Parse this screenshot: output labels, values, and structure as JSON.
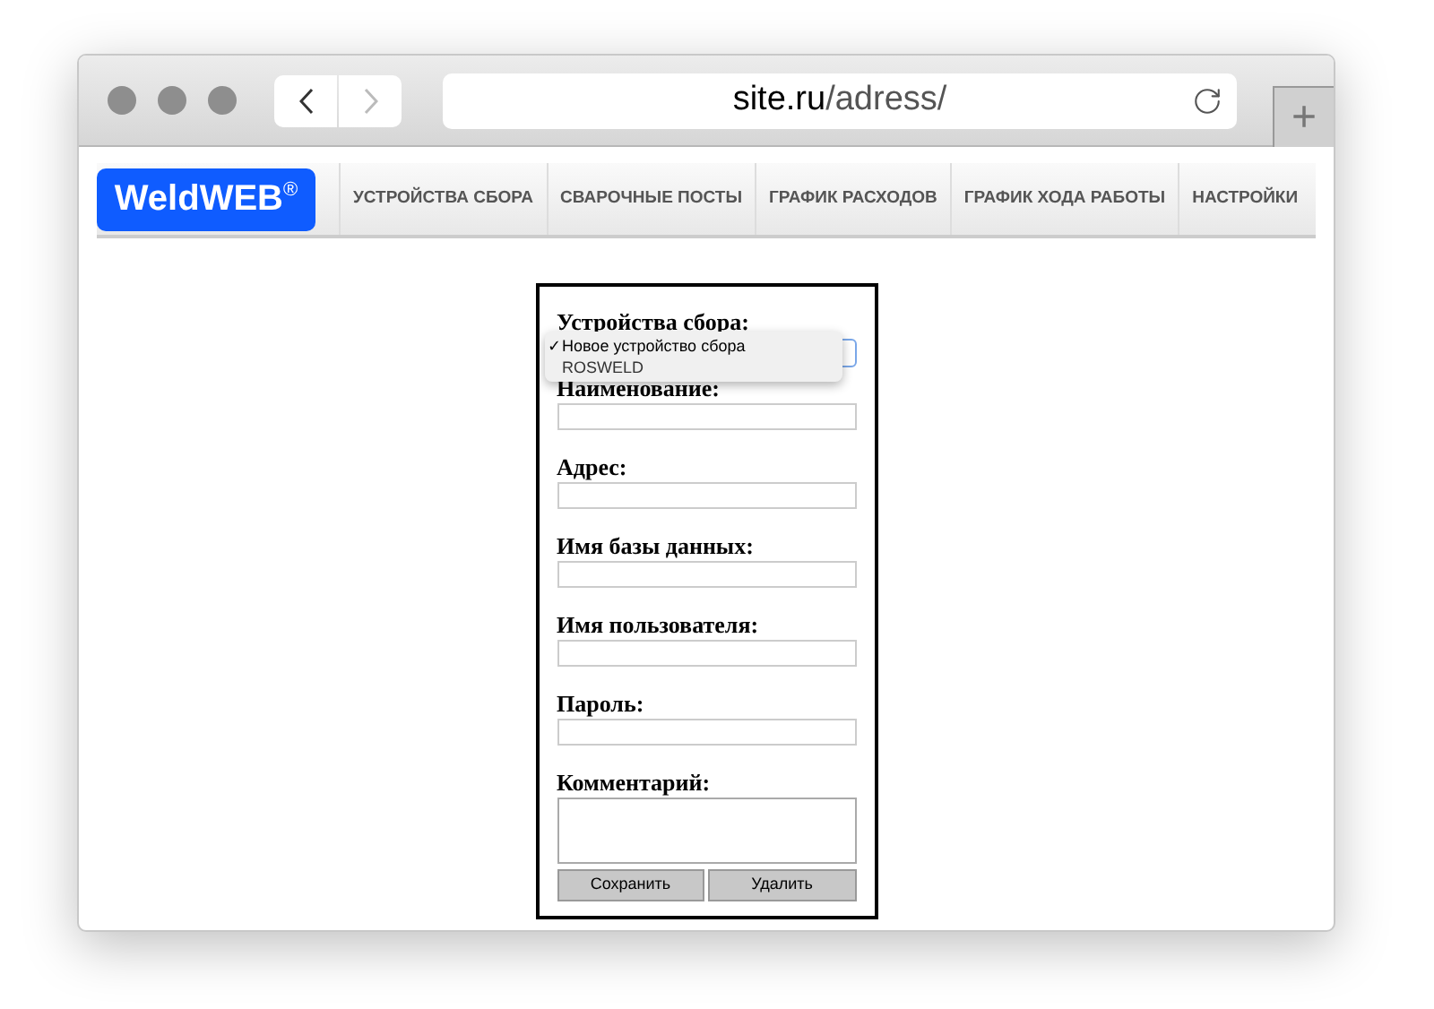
{
  "browser": {
    "url_host": "site.ru",
    "url_path": "/adress/",
    "new_tab": "+"
  },
  "logo": {
    "name": "WeldWEB",
    "mark": "®"
  },
  "nav": [
    {
      "label": "УСТРОЙСТВА СБОРА"
    },
    {
      "label": "СВАРОЧНЫЕ ПОСТЫ"
    },
    {
      "label": "ГРАФИК РАСХОДОВ"
    },
    {
      "label": "ГРАФИК ХОДА РАБОТЫ"
    },
    {
      "label": "НАСТРОЙКИ"
    }
  ],
  "form": {
    "select_label": "Устройства сбора:",
    "check_mark": "✓",
    "options": [
      {
        "label": "Новое устройство сбора",
        "selected": true
      },
      {
        "label": "ROSWELD",
        "selected": false
      }
    ],
    "fields": [
      {
        "label": "Наименование:",
        "kind": "input"
      },
      {
        "label": "Адрес:",
        "kind": "input"
      },
      {
        "label": "Имя базы данных:",
        "kind": "input"
      },
      {
        "label": "Имя пользователя:",
        "kind": "input"
      },
      {
        "label": "Пароль:",
        "kind": "input"
      },
      {
        "label": "Комментарий:",
        "kind": "textarea"
      }
    ],
    "buttons": [
      "Сохранить",
      "Удалить"
    ]
  }
}
